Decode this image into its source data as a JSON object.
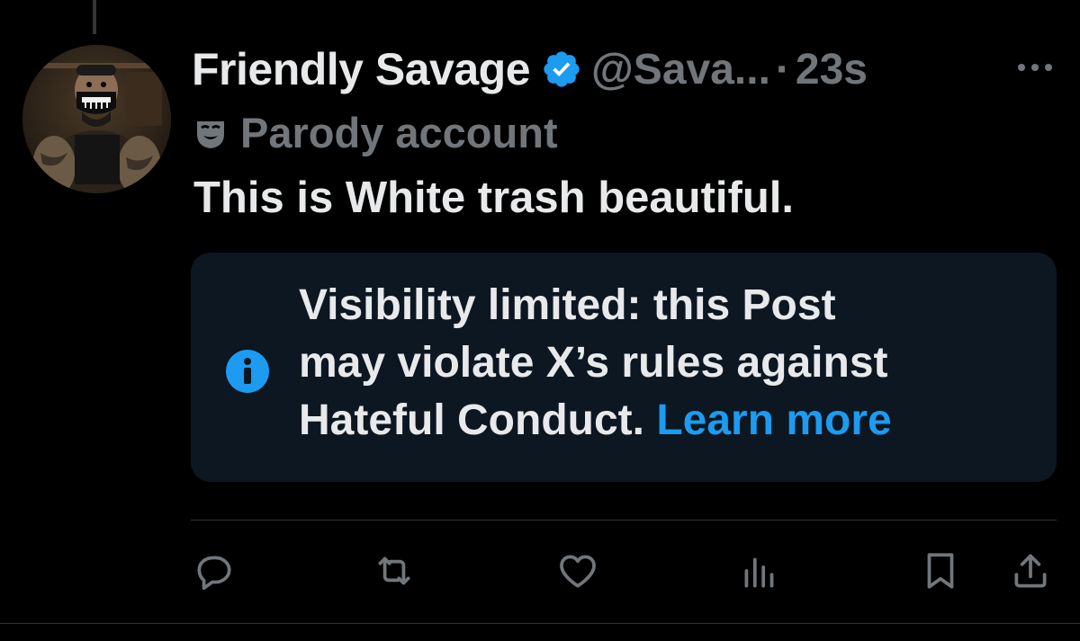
{
  "author": {
    "display_name": "Friendly Savage",
    "handle": "@Sava...",
    "separator": "·",
    "timestamp": "23s",
    "verified": true,
    "badge_color": "#1d9bf0"
  },
  "label": {
    "icon": "theater-mask-icon",
    "text": "Parody account"
  },
  "post": {
    "text": "This is White trash beautiful."
  },
  "notice": {
    "icon": "info-icon",
    "line1": "Visibility limited: this Post",
    "line2": "may violate X’s rules against",
    "line3": "Hateful Conduct.",
    "link": "Learn more",
    "link_color": "#1d9bf0",
    "background": "#0c1722"
  },
  "actions": [
    "reply-icon",
    "repost-icon",
    "like-icon",
    "views-icon",
    "bookmark-icon",
    "share-icon"
  ],
  "colors": {
    "background": "#000000",
    "primary_text": "#e7e9ea",
    "secondary_text": "#71767b",
    "accent": "#1d9bf0"
  }
}
